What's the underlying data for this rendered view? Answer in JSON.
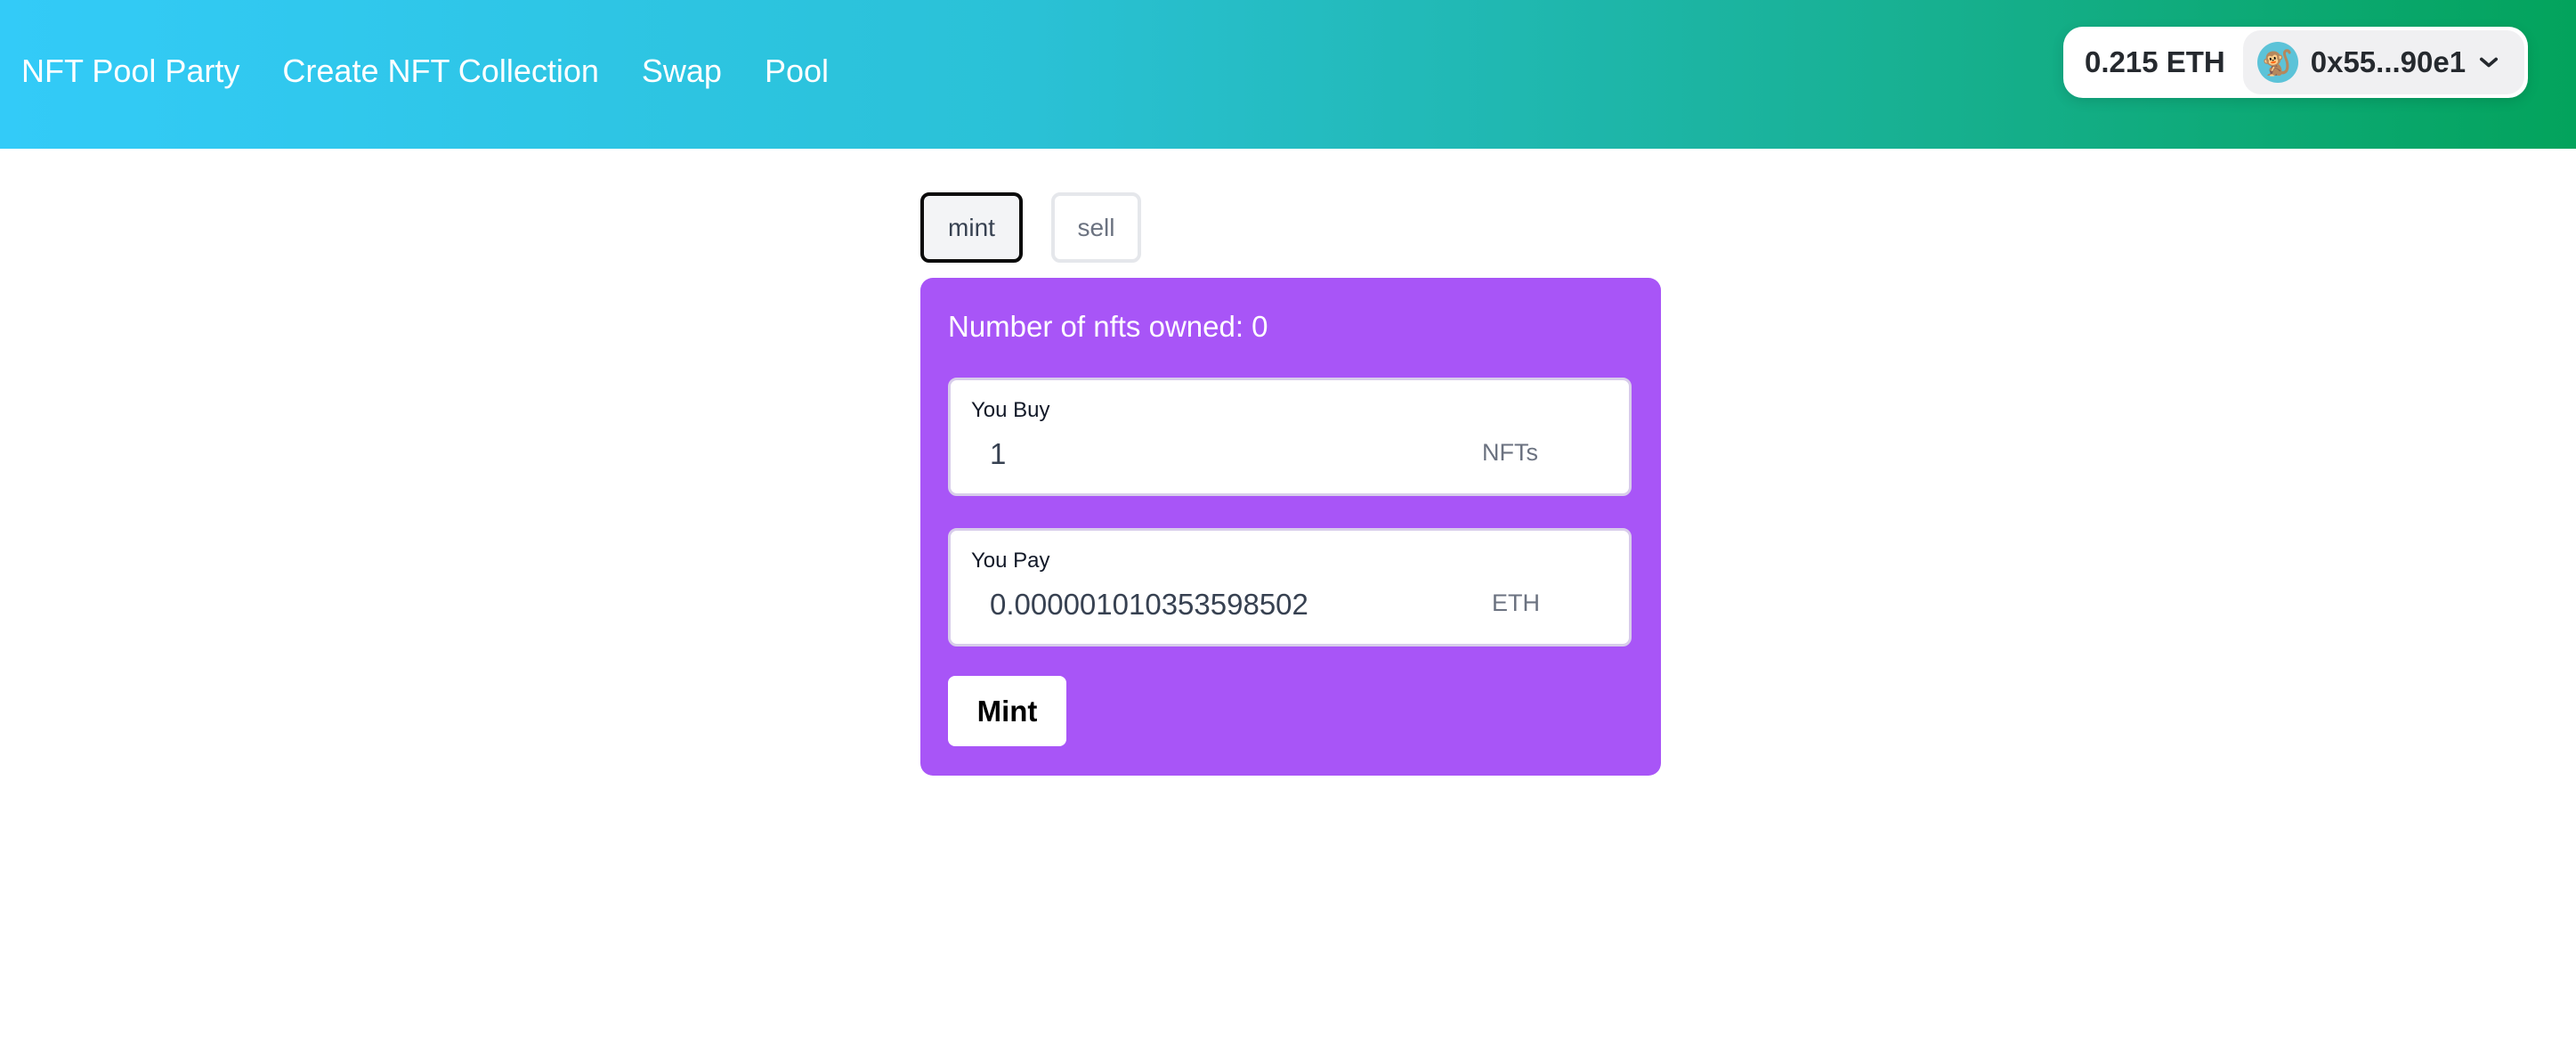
{
  "header": {
    "nav": [
      {
        "label": "NFT Pool Party"
      },
      {
        "label": "Create NFT Collection"
      },
      {
        "label": "Swap"
      },
      {
        "label": "Pool"
      }
    ],
    "wallet": {
      "balance": "0.215 ETH",
      "avatar_icon": "monkey-emoji",
      "avatar_glyph": "🐒",
      "address": "0x55...90e1"
    }
  },
  "tabs": [
    {
      "label": "mint",
      "active": true
    },
    {
      "label": "sell",
      "active": false
    }
  ],
  "card": {
    "owned_text": "Number of nfts owned: 0",
    "buy": {
      "label": "You Buy",
      "value": "1",
      "unit": "NFTs"
    },
    "pay": {
      "label": "You Pay",
      "value": "0.000001010353598502",
      "unit": "ETH"
    },
    "submit_label": "Mint"
  },
  "colors": {
    "card_bg": "#a855f7",
    "header_gradient_start": "#33cbf8",
    "header_gradient_end": "#03a35c"
  }
}
